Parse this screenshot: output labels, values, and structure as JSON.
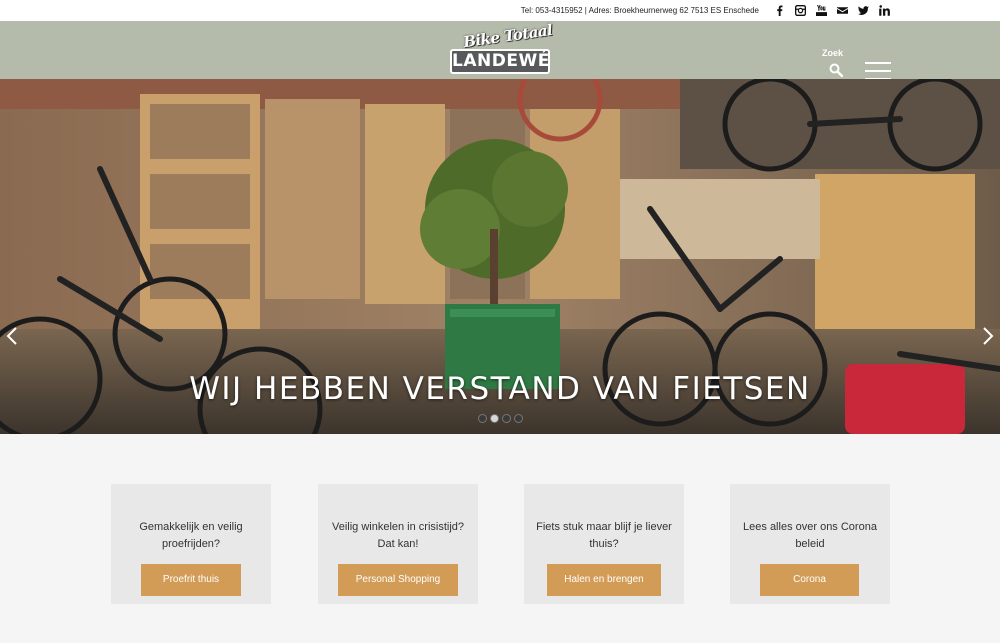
{
  "topbar": {
    "contact": "Tel: 053-4315952 | Adres: Broekheurnerweg 62 7513 ES Enschede",
    "socials": [
      "facebook-icon",
      "instagram-icon",
      "youtube-icon",
      "mail-icon",
      "twitter-icon",
      "linkedin-icon"
    ]
  },
  "header": {
    "logo_script": "Bike Totaal",
    "logo_name": "LANDEWÉ",
    "search_label": "Zoek",
    "background": "#b4bbaa"
  },
  "hero": {
    "title": "WIJ HEBBEN VERSTAND VAN FIETSEN",
    "slide_count": 4,
    "active_slide": 2
  },
  "cards": [
    {
      "text": "Gemakkelijk en veilig proefrijden?",
      "button": "Proefrit thuis"
    },
    {
      "text": "Veilig winkelen in crisistijd? Dat kan!",
      "button": "Personal Shopping"
    },
    {
      "text": "Fiets stuk maar blijf je liever thuis?",
      "button": "Halen en brengen"
    },
    {
      "text": "Lees alles over ons Corona beleid",
      "button": "Corona"
    }
  ],
  "colors": {
    "accent": "#d29c56",
    "card_bg": "#e8e8e8"
  }
}
